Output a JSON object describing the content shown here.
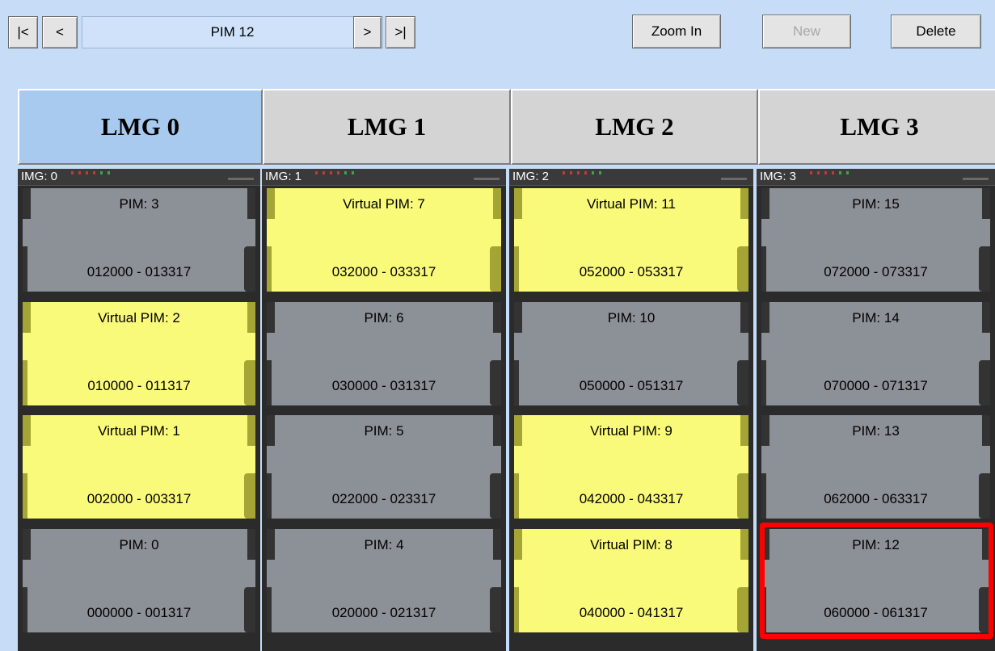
{
  "toolbar": {
    "first_label": "|<",
    "prev_label": "<",
    "current": "PIM 12",
    "next_label": ">",
    "last_label": ">|",
    "zoom_in": "Zoom In",
    "new": "New",
    "delete": "Delete"
  },
  "lmgs": [
    {
      "label": "LMG 0",
      "active": true
    },
    {
      "label": "LMG 1",
      "active": false
    },
    {
      "label": "LMG 2",
      "active": false
    },
    {
      "label": "LMG 3",
      "active": false
    }
  ],
  "columns": [
    {
      "img": "IMG: 0",
      "pims": [
        {
          "name": "PIM: 3",
          "range": "012000 - 013317",
          "virtual": false
        },
        {
          "name": "Virtual  PIM: 2",
          "range": "010000 - 011317",
          "virtual": true
        },
        {
          "name": "Virtual  PIM: 1",
          "range": "002000 - 003317",
          "virtual": true
        },
        {
          "name": "PIM: 0",
          "range": "000000 - 001317",
          "virtual": false
        }
      ]
    },
    {
      "img": "IMG: 1",
      "pims": [
        {
          "name": "Virtual  PIM: 7",
          "range": "032000 - 033317",
          "virtual": true
        },
        {
          "name": "PIM: 6",
          "range": "030000 - 031317",
          "virtual": false
        },
        {
          "name": "PIM: 5",
          "range": "022000 - 023317",
          "virtual": false
        },
        {
          "name": "PIM: 4",
          "range": "020000 - 021317",
          "virtual": false
        }
      ]
    },
    {
      "img": "IMG: 2",
      "pims": [
        {
          "name": "Virtual  PIM: 11",
          "range": "052000 - 053317",
          "virtual": true
        },
        {
          "name": "PIM: 10",
          "range": "050000 - 051317",
          "virtual": false
        },
        {
          "name": "Virtual  PIM: 9",
          "range": "042000 - 043317",
          "virtual": true
        },
        {
          "name": "Virtual  PIM: 8",
          "range": "040000 - 041317",
          "virtual": true
        }
      ]
    },
    {
      "img": "IMG: 3",
      "pims": [
        {
          "name": "PIM: 15",
          "range": "072000 - 073317",
          "virtual": false
        },
        {
          "name": "PIM: 14",
          "range": "070000 - 071317",
          "virtual": false
        },
        {
          "name": "PIM: 13",
          "range": "062000 - 063317",
          "virtual": false
        },
        {
          "name": "PIM: 12",
          "range": "060000 - 061317",
          "virtual": false,
          "selected": true
        }
      ]
    }
  ],
  "colors": {
    "background": "#c6dcf7",
    "virtual_pim": "#f9f97a",
    "pim": "#8c9097",
    "selection": "#ff0000",
    "active_tab": "#a9caef"
  }
}
